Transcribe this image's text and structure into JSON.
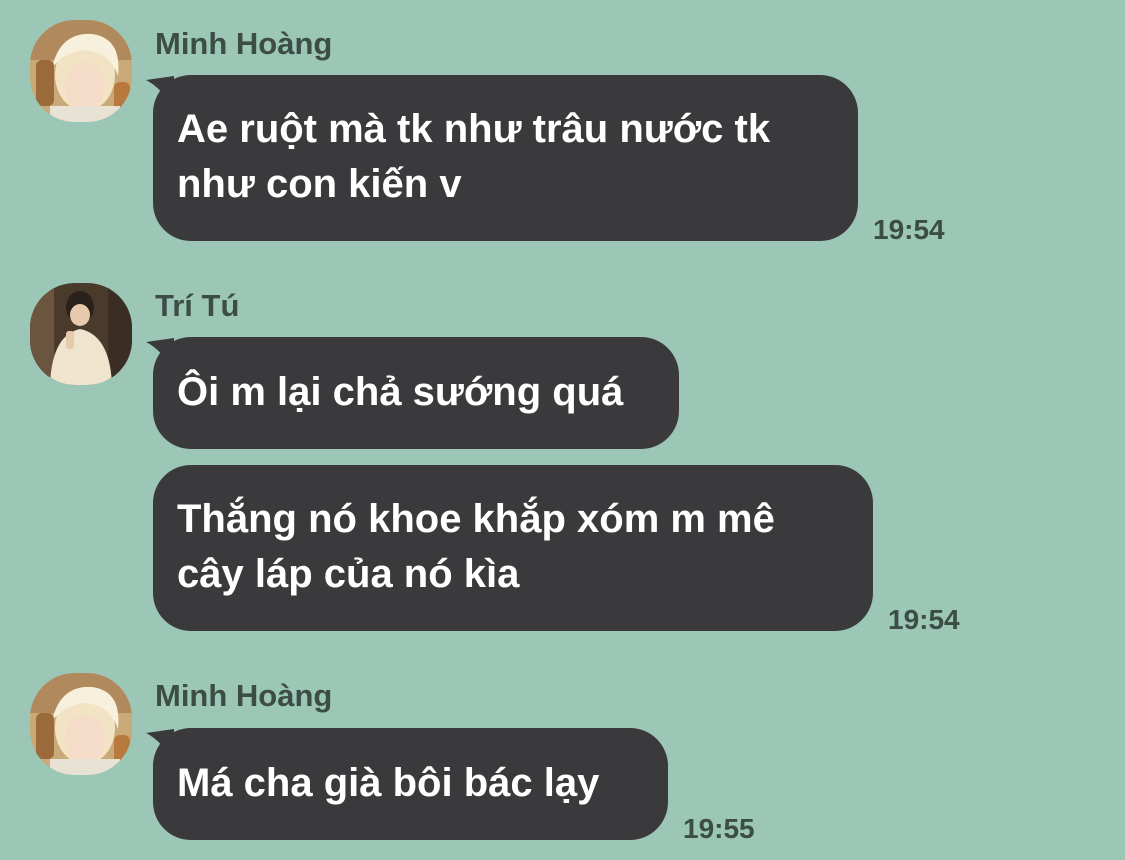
{
  "conversation": {
    "groups": [
      {
        "sender": "Minh Hoàng",
        "avatar_icon": "user-avatar-blonde-icon",
        "messages": [
          {
            "lines": [
              "Ae ruột mà tk như trâu nước tk",
              "như con kiến v"
            ],
            "time": "19:54"
          }
        ]
      },
      {
        "sender": "Trí Tú",
        "avatar_icon": "user-avatar-dark-hair-icon",
        "messages": [
          {
            "lines": [
              "Ôi m lại chả sướng quá"
            ],
            "time": ""
          },
          {
            "lines": [
              "Thắng nó khoe khắp xóm m mê",
              "cây láp của nó kìa"
            ],
            "time": "19:54"
          }
        ]
      },
      {
        "sender": "Minh Hoàng",
        "avatar_icon": "user-avatar-blonde-icon",
        "messages": [
          {
            "lines": [
              "Má cha già bôi bác lạy"
            ],
            "time": "19:55"
          }
        ]
      }
    ]
  },
  "colors": {
    "background": "#9cc7b6",
    "bubble": "#3a3a3c",
    "bubble_text": "#ffffff",
    "meta_text": "#3c4d46"
  }
}
